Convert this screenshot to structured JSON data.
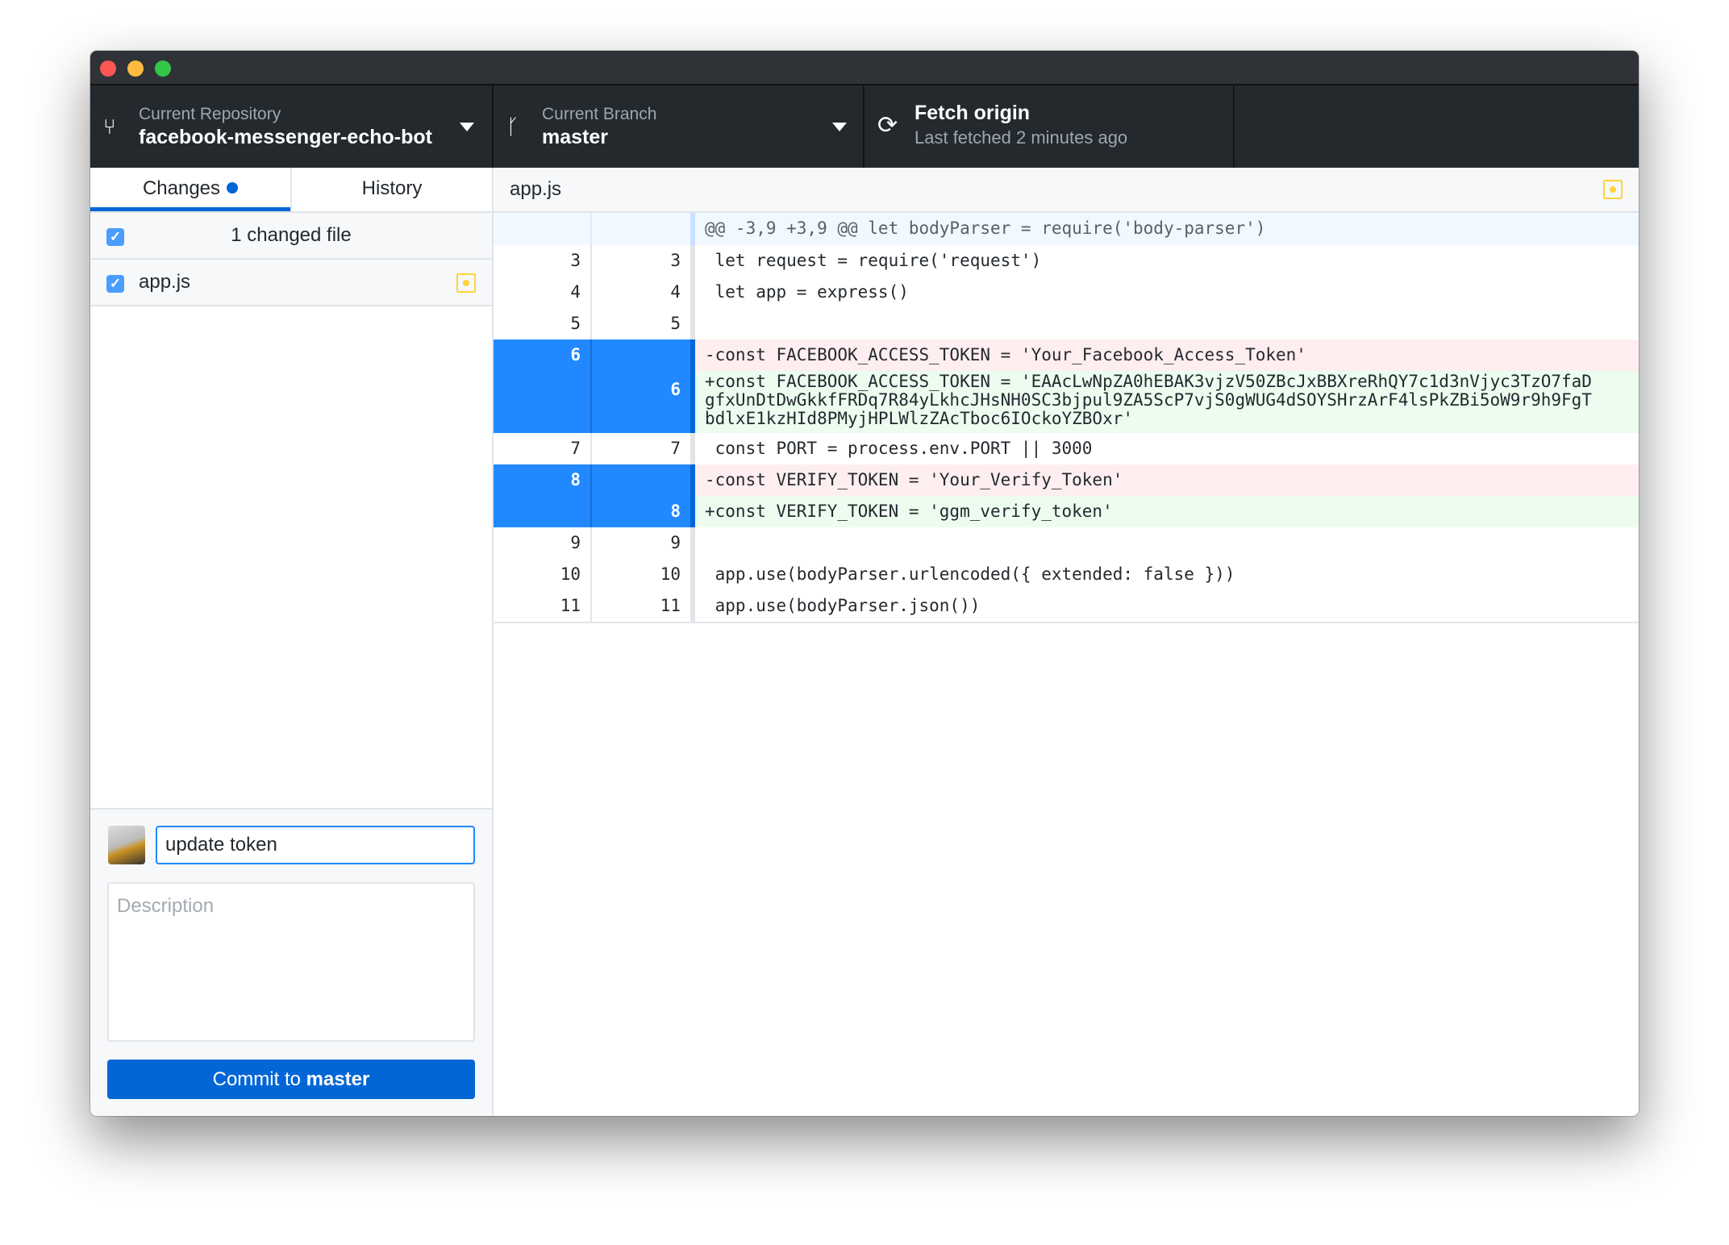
{
  "toolbar": {
    "repository": {
      "label": "Current Repository",
      "value": "facebook-messenger-echo-bot"
    },
    "branch": {
      "label": "Current Branch",
      "value": "master"
    },
    "fetch": {
      "label": "Fetch origin",
      "status": "Last fetched 2 minutes ago"
    }
  },
  "sidebar": {
    "tabs": [
      {
        "label": "Changes"
      },
      {
        "label": "History"
      }
    ],
    "changed_count": "1 changed file",
    "files": [
      {
        "name": "app.js",
        "status": "modified"
      }
    ],
    "commit": {
      "summary": "update token",
      "description_placeholder": "Description",
      "button_prefix": "Commit to ",
      "button_branch": "master"
    }
  },
  "diff": {
    "file": "app.js",
    "hunk": "@@ -3,9 +3,9 @@ let bodyParser = require('body-parser')",
    "lines": [
      {
        "old": "3",
        "new": "3",
        "text": " let request = require('request')"
      },
      {
        "old": "4",
        "new": "4",
        "text": " let app = express()"
      },
      {
        "old": "5",
        "new": "5",
        "text": " "
      },
      {
        "old": "6",
        "new": "",
        "text": "-const FACEBOOK_ACCESS_TOKEN = 'Your_Facebook_Access_Token'"
      },
      {
        "old": "",
        "new": "6",
        "text": "+const FACEBOOK_ACCESS_TOKEN = 'EAAcLwNpZA0hEBAK3vjzV50ZBcJxBBXreRhQY7c1d3nVjyc3TzO7faD\ngfxUnDtDwGkkfFRDq7R84yLkhcJHsNH0SC3bjpul9ZA5ScP7vjS0gWUG4dSOYSHrzArF4lsPkZBi5oW9r9h9FgT\nbdlxE1kzHId8PMyjHPLWlzZAcTboc6IOckoYZBOxr'"
      },
      {
        "old": "7",
        "new": "7",
        "text": " const PORT = process.env.PORT || 3000"
      },
      {
        "old": "8",
        "new": "",
        "text": "-const VERIFY_TOKEN = 'Your_Verify_Token'"
      },
      {
        "old": "",
        "new": "8",
        "text": "+const VERIFY_TOKEN = 'ggm_verify_token'"
      },
      {
        "old": "9",
        "new": "9",
        "text": " "
      },
      {
        "old": "10",
        "new": "10",
        "text": " app.use(bodyParser.urlencoded({ extended: false }))"
      },
      {
        "old": "11",
        "new": "11",
        "text": " app.use(bodyParser.json())"
      }
    ]
  },
  "colors": {
    "accent": "#0366d6",
    "modified": "#ffd33d",
    "deleted_bg": "#ffeef0",
    "added_bg": "#ecfdf0",
    "toolbar_bg": "#24292e"
  }
}
